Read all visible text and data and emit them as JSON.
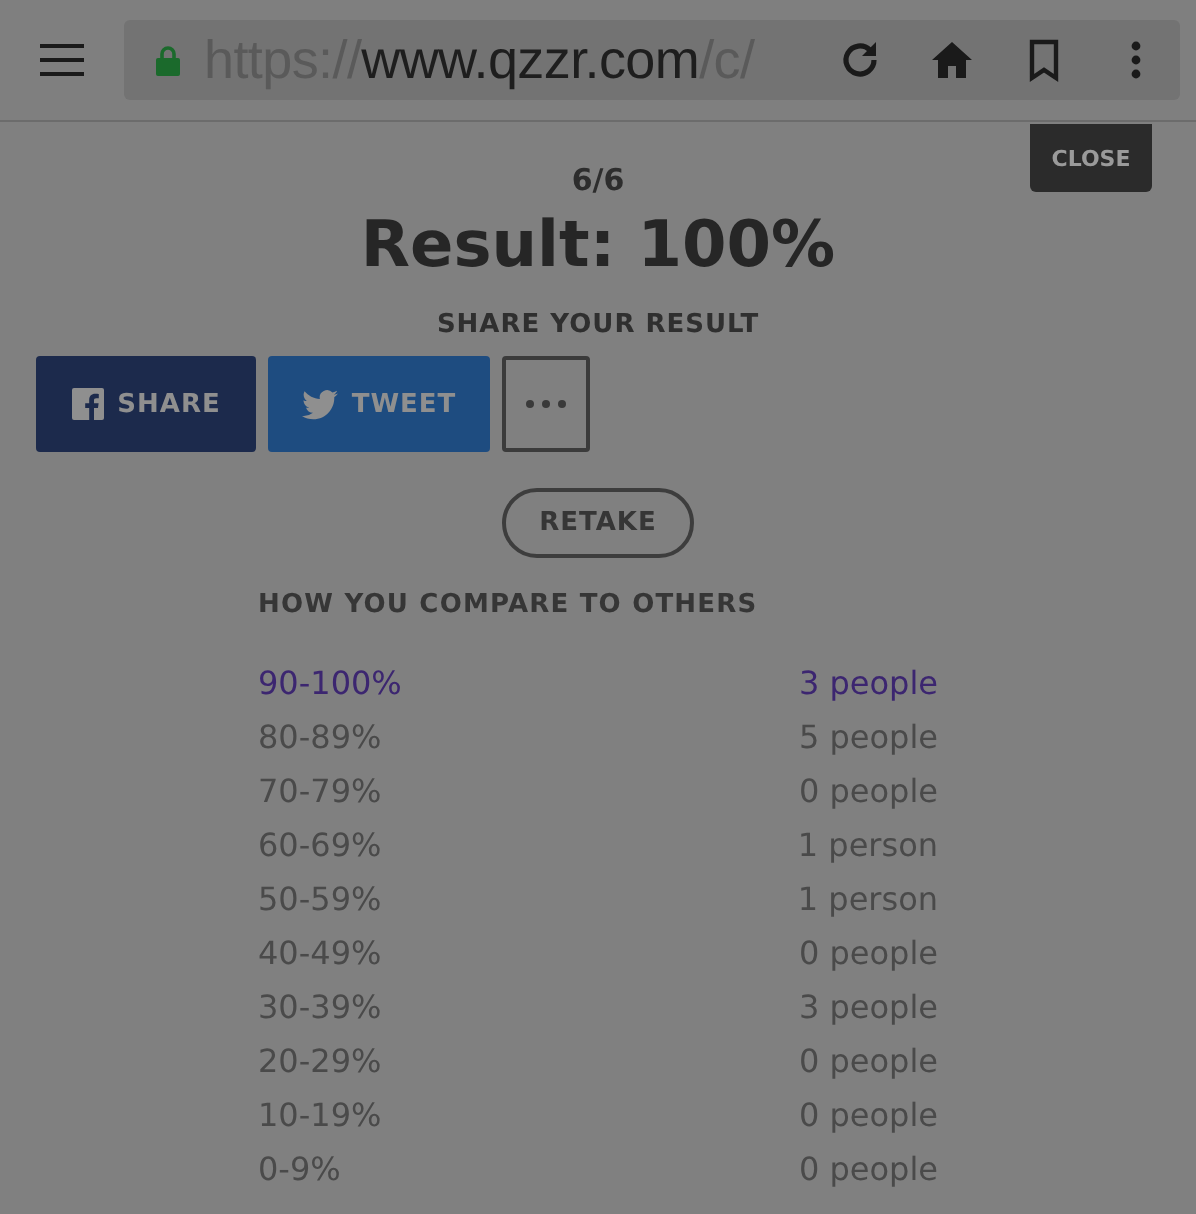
{
  "browser": {
    "url_scheme": "https://",
    "url_host": "www.qzzr.com",
    "url_path": "/c/"
  },
  "close_button": "CLOSE",
  "progress": "6/6",
  "result": "Result: 100%",
  "share": {
    "heading": "SHARE YOUR RESULT",
    "buttons": [
      {
        "kind": "facebook",
        "label": "SHARE"
      },
      {
        "kind": "twitter",
        "label": "TWEET"
      },
      {
        "kind": "more"
      }
    ]
  },
  "retake_button": "RETAKE",
  "compare": {
    "heading": "HOW YOU COMPARE TO OTHERS",
    "rows": [
      {
        "range": "90-100%",
        "count": "3 people",
        "selected": true
      },
      {
        "range": "80-89%",
        "count": "5 people",
        "selected": false
      },
      {
        "range": "70-79%",
        "count": "0 people",
        "selected": false
      },
      {
        "range": "60-69%",
        "count": "1 person",
        "selected": false
      },
      {
        "range": "50-59%",
        "count": "1 person",
        "selected": false
      },
      {
        "range": "40-49%",
        "count": "0 people",
        "selected": false
      },
      {
        "range": "30-39%",
        "count": "3 people",
        "selected": false
      },
      {
        "range": "20-29%",
        "count": "0 people",
        "selected": false
      },
      {
        "range": "10-19%",
        "count": "0 people",
        "selected": false
      },
      {
        "range": "0-9%",
        "count": "0 people",
        "selected": false
      }
    ]
  }
}
